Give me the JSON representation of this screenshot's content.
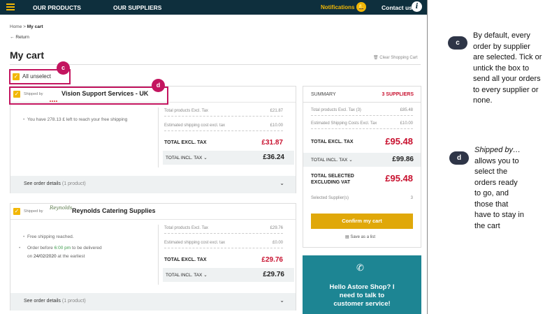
{
  "nav": {
    "products": "OUR PRODUCTS",
    "suppliers": "OUR SUPPLIERS",
    "notifications": "Notifications",
    "contact": "Contact us",
    "info_glyph": "i"
  },
  "breadcrumb": {
    "home": "Home",
    "sep": ">",
    "current": "My cart"
  },
  "return_label": "Return",
  "page_title": "My cart",
  "clear_cart": "Clear Shopping Cart",
  "all_unselect": "All unselect",
  "shipped_by": "Shipped by",
  "suppliers": [
    {
      "name": "Vision Support Services - UK",
      "note": "You have 278.13 £ left to reach your free shipping",
      "products_label": "Total products Excl. Tax",
      "products_value": "£21.87",
      "shipping_label": "Estimated shipping cost excl. tax",
      "shipping_value": "£10.00",
      "total_excl_label": "TOTAL EXCL. TAX",
      "total_excl_value": "£31.87",
      "total_incl_label": "TOTAL INCL. TAX",
      "total_incl_value": "£36.24",
      "details_label": "See order details",
      "details_count": "(1 product)"
    },
    {
      "name": "Reynolds Catering Supplies",
      "logo_text": "Reynolds",
      "note1": "Free shipping reached.",
      "note2_a": "Order before",
      "note2_time": "6:00 pm",
      "note2_b": "to be delivered on",
      "note2_date": "24/02/2020",
      "note2_c": "at the earliest",
      "products_label": "Total products Excl. Tax",
      "products_value": "£29.76",
      "shipping_label": "Estimated shipping cost excl. tax",
      "shipping_value": "£0.00",
      "total_excl_label": "TOTAL EXCL. TAX",
      "total_excl_value": "£29.76",
      "total_incl_label": "TOTAL INCL. TAX",
      "total_incl_value": "£29.76",
      "details_label": "See order details",
      "details_count": "(1 product)"
    }
  ],
  "summary": {
    "title": "SUMMARY",
    "count": "3 SUPPLIERS",
    "products_label": "Total products Excl. Tax (3)",
    "products_value": "£85.48",
    "shipping_label": "Estimated Shipping Costs Excl. Tax",
    "shipping_value": "£10.00",
    "total_excl_label": "TOTAL EXCL. TAX",
    "total_excl_value": "£95.48",
    "total_incl_label": "TOTAL INCL. TAX",
    "total_incl_value": "£99.86",
    "selected_label_1": "TOTAL SELECTED",
    "selected_label_2": "EXCLUDING VAT",
    "selected_value": "£95.48",
    "selected_suppliers_label": "Selected Supplier(s)",
    "selected_suppliers_value": "3",
    "confirm": "Confirm my cart",
    "save_list": "Save as a list"
  },
  "help": {
    "line1": "Hello Astore Shop? I",
    "line2": "need to talk to",
    "line3": "customer service!"
  },
  "callouts": {
    "c": "c",
    "d": "d",
    "c_text": [
      "By default, every",
      "order by supplier",
      "are selected. Tick or",
      "untick the box to",
      "send all your orders",
      "to every supplier or",
      "none."
    ],
    "d_text_em": "Shipped by…",
    "d_text": [
      "allows you to",
      "select the",
      "orders ready",
      "to go, and",
      "those that",
      "have to stay in",
      "the cart"
    ]
  },
  "colors": {
    "accent": "#f2b705",
    "nav_bg": "#0e2f3d",
    "price_red": "#c8102e",
    "callout": "#c3155f",
    "help_bg": "#1d8593"
  }
}
